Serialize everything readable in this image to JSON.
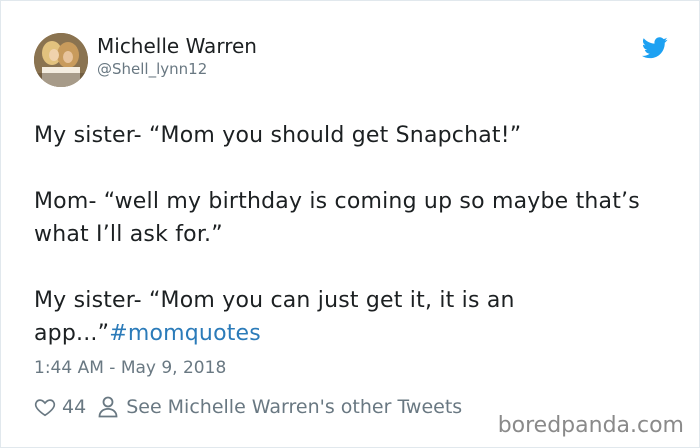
{
  "author": {
    "display_name": "Michelle Warren",
    "screen_name": "@Shell_lynn12"
  },
  "tweet": {
    "line1": "My sister- “Mom you should get Snapchat!”",
    "line2": "Mom- “well my birthday is coming up so maybe that’s what I’ll ask for.”",
    "line3_text": "My sister- “Mom you can just get it, it is an app...”",
    "hashtag": "#momquotes",
    "timestamp": "1:44 AM - May 9, 2018"
  },
  "actions": {
    "like_count": "44",
    "other_tweets_label": "See Michelle Warren's other Tweets"
  },
  "watermark": "boredpanda.com",
  "colors": {
    "text": "#1c2022",
    "secondary": "#697882",
    "link": "#2b7bb9",
    "twitter_blue": "#1da1f2"
  },
  "icons": {
    "brand": "twitter-bird-icon",
    "like": "heart-icon",
    "profile": "person-icon"
  }
}
